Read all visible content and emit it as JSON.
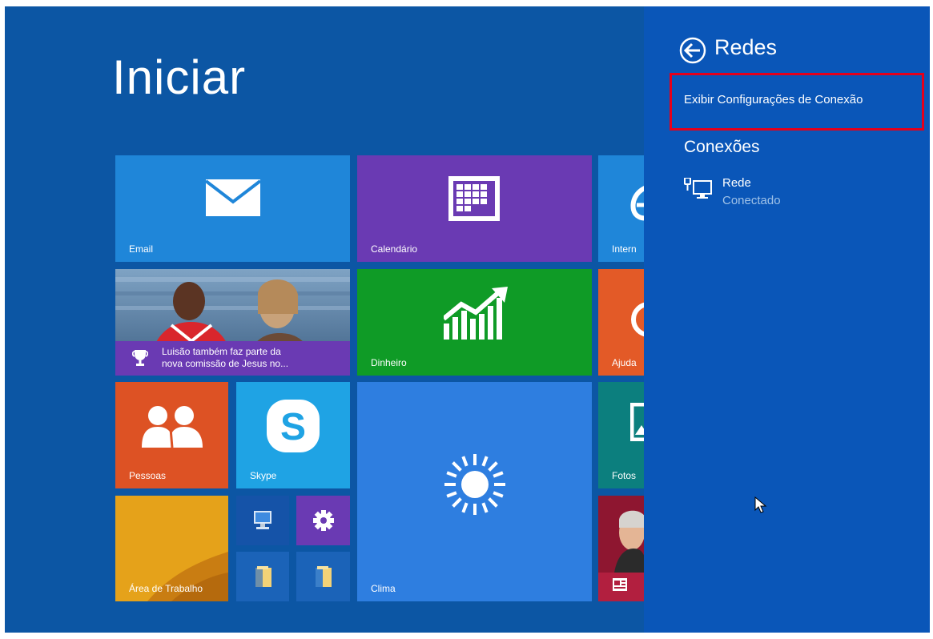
{
  "start": {
    "title": "Iniciar"
  },
  "tiles": {
    "email": "Email",
    "calendar": "Calendário",
    "ie": "Intern",
    "sports_headline_line1": "Luisão também faz parte da",
    "sports_headline_line2": "nova comissão de Jesus no...",
    "money": "Dinheiro",
    "help": "Ajuda",
    "people": "Pessoas",
    "skype": "Skype",
    "weather": "Clima",
    "photos": "Fotos",
    "desktop": "Área de Trabalho"
  },
  "panel": {
    "title": "Redes",
    "view_settings_link": "Exibir Configurações de Conexão",
    "connections_heading": "Conexões",
    "network": {
      "name": "Rede",
      "status": "Conectado"
    }
  },
  "colors": {
    "start_background": "#0c56a4",
    "charm_panel": "#0a56b8",
    "highlight_border": "#e4001b"
  }
}
